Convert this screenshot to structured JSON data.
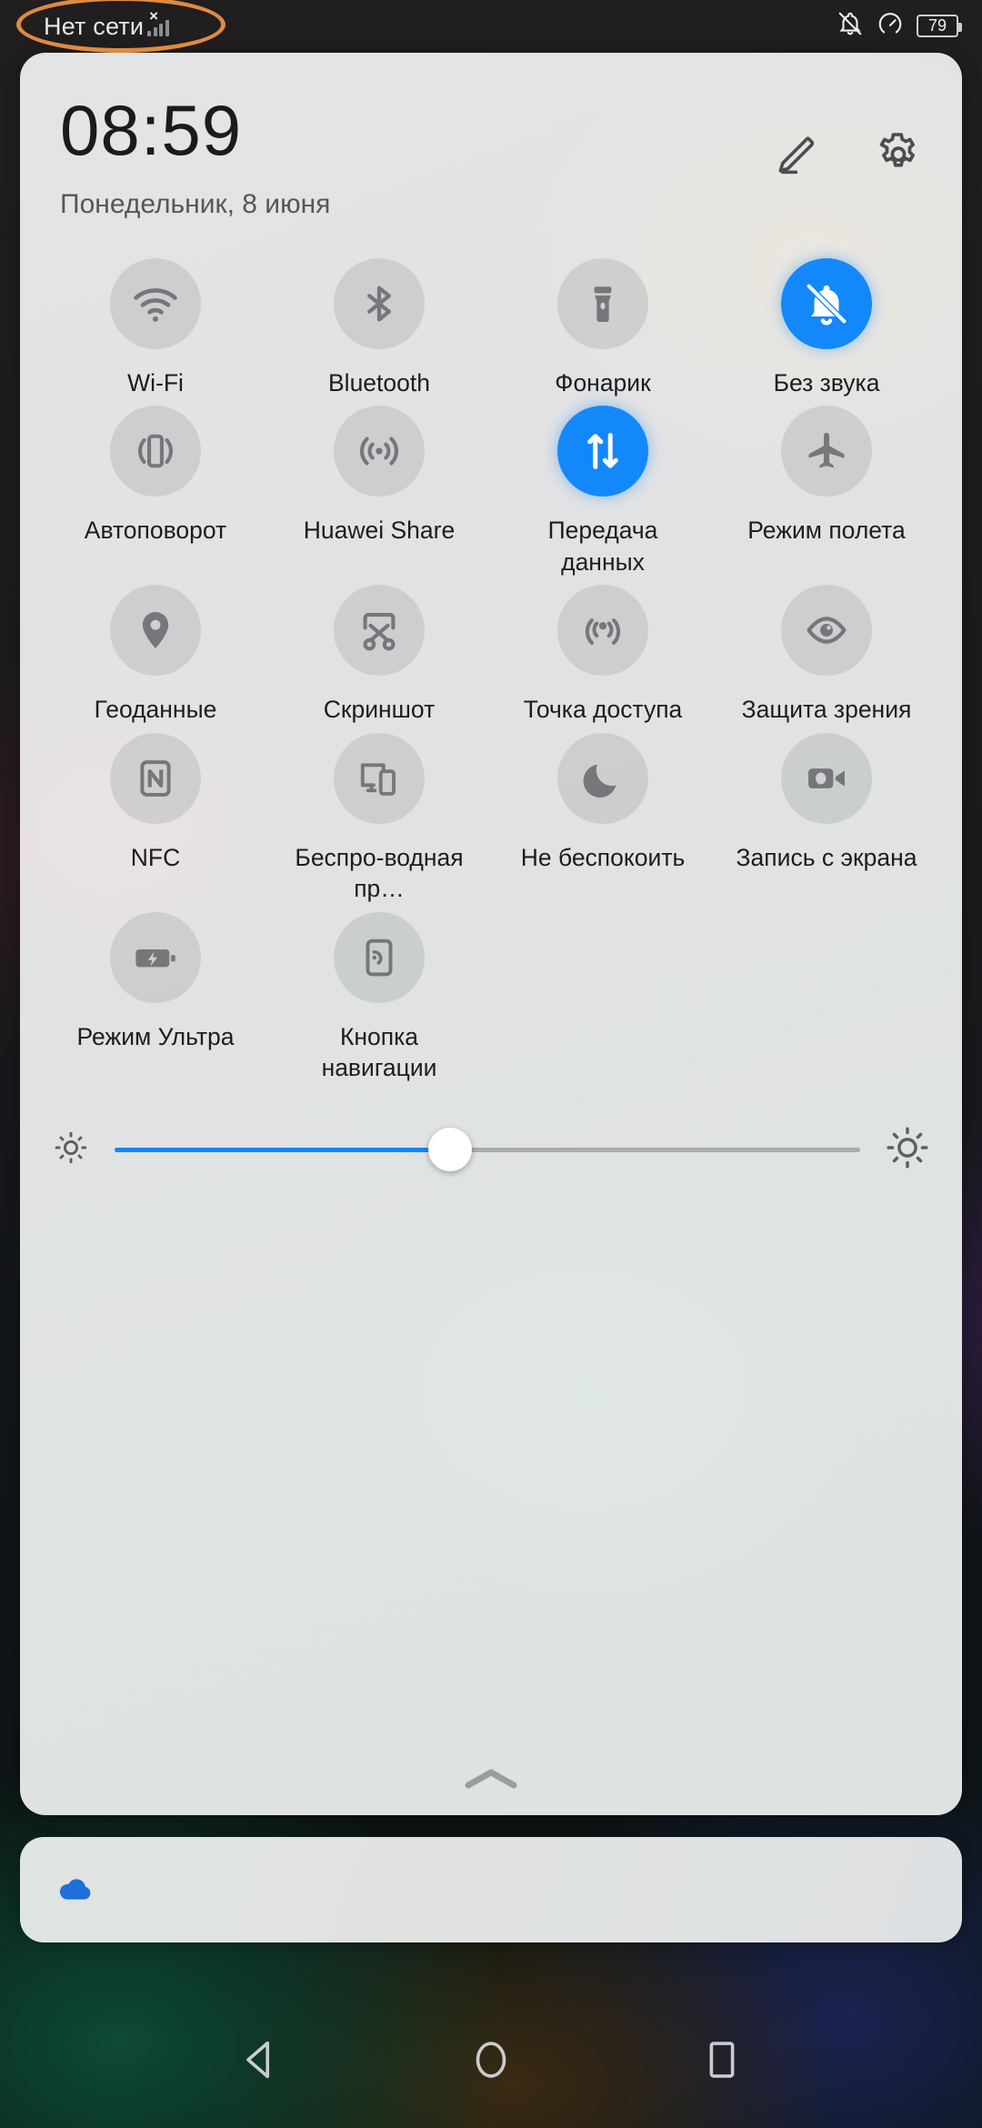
{
  "status_bar": {
    "carrier_text": "Нет сети",
    "signal_icon": "signal-no-service-icon",
    "mute_icon": "bell-muted-icon",
    "dnd_icon": "speed-dial-icon",
    "battery_level": "79"
  },
  "highlight": {
    "shape": "ellipse",
    "color": "#e08a42",
    "target": "carrier-status-area"
  },
  "panel": {
    "clock": "08:59",
    "date": "Понедельник, 8 июня",
    "edit_icon": "pencil-edit-icon",
    "settings_icon": "gear-icon",
    "collapse_icon": "chevron-up-icon"
  },
  "accent_color": "#1288fb",
  "tiles": [
    {
      "label": "Wi-Fi",
      "icon": "wifi-icon",
      "active": false
    },
    {
      "label": "Bluetooth",
      "icon": "bluetooth-icon",
      "active": false
    },
    {
      "label": "Фонарик",
      "icon": "flashlight-icon",
      "active": false
    },
    {
      "label": "Без звука",
      "icon": "bell-muted-icon",
      "active": true
    },
    {
      "label": "Автоповорот",
      "icon": "auto-rotate-icon",
      "active": false
    },
    {
      "label": "Huawei Share",
      "icon": "huawei-share-icon",
      "active": false
    },
    {
      "label": "Передача данных",
      "icon": "mobile-data-icon",
      "active": true
    },
    {
      "label": "Режим полета",
      "icon": "airplane-icon",
      "active": false
    },
    {
      "label": "Геоданные",
      "icon": "location-pin-icon",
      "active": false
    },
    {
      "label": "Скриншот",
      "icon": "scissors-icon",
      "active": false
    },
    {
      "label": "Точка доступа",
      "icon": "hotspot-icon",
      "active": false
    },
    {
      "label": "Защита зрения",
      "icon": "eye-icon",
      "active": false
    },
    {
      "label": "NFC",
      "icon": "nfc-icon",
      "active": false
    },
    {
      "label": "Беспро-водная пр…",
      "icon": "wireless-cast-icon",
      "active": false
    },
    {
      "label": "Не беспокоить",
      "icon": "moon-icon",
      "active": false
    },
    {
      "label": "Запись с экрана",
      "icon": "camcorder-icon",
      "active": false
    },
    {
      "label": "Режим Ультра",
      "icon": "battery-saver-icon",
      "active": false
    },
    {
      "label": "Кнопка навигации",
      "icon": "nav-button-icon",
      "active": false
    }
  ],
  "brightness": {
    "value_percent": 45,
    "low_icon": "brightness-low-icon",
    "high_icon": "brightness-high-icon"
  },
  "notification": {
    "icon": "cloud-icon",
    "icon_color": "#1e6fd9"
  },
  "navbar": {
    "back_icon": "back-triangle-icon",
    "home_icon": "home-circle-icon",
    "recents_icon": "recents-square-icon"
  }
}
